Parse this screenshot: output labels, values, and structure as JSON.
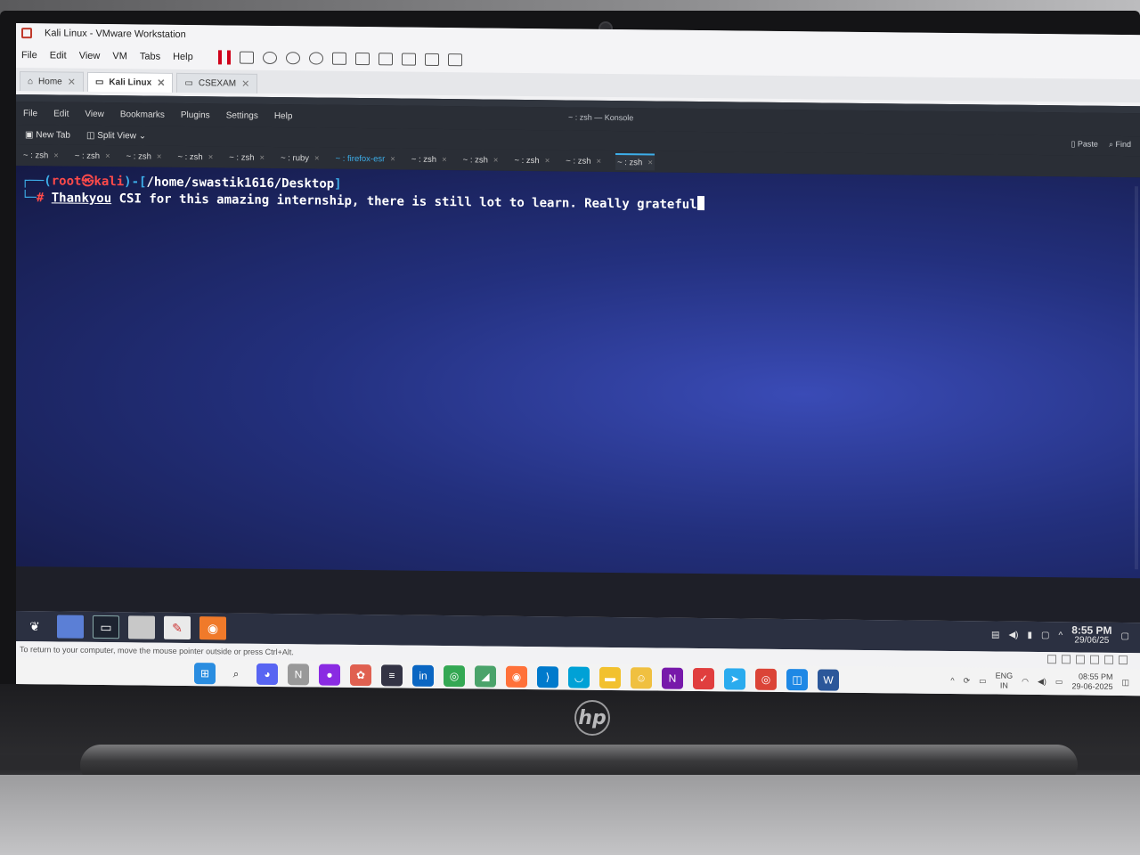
{
  "vmware": {
    "window_title": "Kali Linux - VMware Workstation",
    "menu": [
      "File",
      "Edit",
      "View",
      "VM",
      "Tabs",
      "Help"
    ],
    "tabs": [
      {
        "label": "Home",
        "active": false
      },
      {
        "label": "Kali Linux",
        "active": true
      },
      {
        "label": "CSEXAM",
        "active": false
      }
    ],
    "status_hint": "To return to your computer, move the mouse pointer outside or press Ctrl+Alt."
  },
  "konsole": {
    "window_title": "~ : zsh — Konsole",
    "menu": [
      "File",
      "Edit",
      "View",
      "Bookmarks",
      "Plugins",
      "Settings",
      "Help"
    ],
    "toolbar": {
      "new_tab": "New Tab",
      "split_view": "Split View",
      "paste": "Paste",
      "find": "Find"
    },
    "tabs": [
      {
        "label": "~ : zsh"
      },
      {
        "label": "~ : zsh"
      },
      {
        "label": "~ : zsh"
      },
      {
        "label": "~ : zsh"
      },
      {
        "label": "~ : zsh"
      },
      {
        "label": "~ : ruby"
      },
      {
        "label": "~ : firefox-esr"
      },
      {
        "label": "~ : zsh"
      },
      {
        "label": "~ : zsh"
      },
      {
        "label": "~ : zsh"
      },
      {
        "label": "~ : zsh"
      },
      {
        "label": "~ : zsh"
      }
    ],
    "prompt": {
      "user": "root",
      "at": "㉿",
      "host": "kali",
      "path": "/home/swastik1616/Desktop",
      "symbol": "#"
    },
    "command_first_word": "Thankyou",
    "command_rest": " CSI for this amazing internship, there is still lot to learn. Really grateful"
  },
  "kali_taskbar": {
    "time": "8:55 PM",
    "date": "29/06/25"
  },
  "windows_taskbar": {
    "lang": "ENG",
    "region": "IN",
    "time": "08:55 PM",
    "date": "29-06-2025"
  },
  "laptop": {
    "brand": "hp"
  },
  "colors": {
    "terminal_bg": "#23307e",
    "prompt_blue": "#3daee9",
    "prompt_red": "#ff4a4a"
  }
}
